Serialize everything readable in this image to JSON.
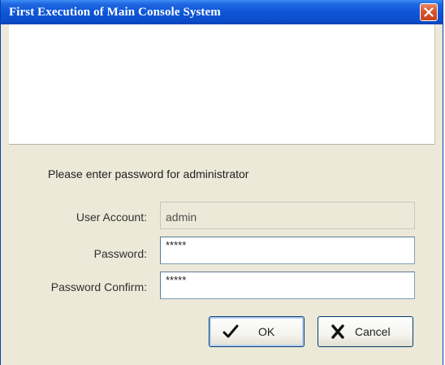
{
  "window": {
    "title": "First Execution of Main Console System"
  },
  "form": {
    "instruction": "Please enter password for administrator",
    "user_account_label": "User Account:",
    "user_account_value": "admin",
    "password_label": "Password:",
    "password_value": "*****",
    "password_confirm_label": "Password Confirm:",
    "password_confirm_value": "*****"
  },
  "buttons": {
    "ok_label": "OK",
    "ok_icon": "checkmark-icon",
    "cancel_label": "Cancel",
    "cancel_icon": "x-icon"
  },
  "colors": {
    "titlebar": "#0d56d8",
    "close_button": "#d9552f",
    "dialog_background": "#ece9d8"
  }
}
